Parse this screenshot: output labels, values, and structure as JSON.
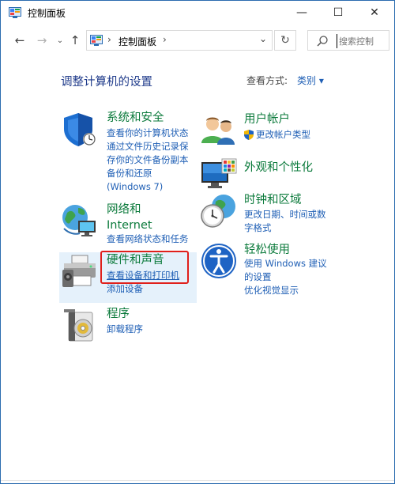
{
  "window": {
    "title": "控制面板",
    "controls": {
      "minimize": "—",
      "maximize": "☐",
      "close": "✕"
    }
  },
  "nav": {
    "back": "←",
    "forward": "→",
    "recent": "⌄",
    "up": "↑",
    "address_chevron_1": "›",
    "address_text": "控制面板",
    "address_chevron_2": "›",
    "address_dropdown": "⌄",
    "refresh": "↻",
    "search_placeholder": "搜索控制"
  },
  "main": {
    "heading": "调整计算机的设置",
    "view_by_label": "查看方式:",
    "view_by_value": "类别 ▾",
    "categories": [
      {
        "title": "系统和安全",
        "icon": "shield-icon",
        "links": [
          "查看你的计算机状态",
          "通过文件历史记录保",
          "存你的文件备份副本",
          "备份和还原",
          "(Windows 7)"
        ]
      },
      {
        "title_line1": "网络和",
        "title_line2": "Internet",
        "icon": "network-globe-icon",
        "links": [
          "查看网络状态和任务"
        ]
      },
      {
        "title": "硬件和声音",
        "icon": "printer-icon",
        "links": [
          "查看设备和打印机",
          "添加设备"
        ]
      },
      {
        "title": "程序",
        "icon": "programs-disc-icon",
        "links": [
          "卸载程序"
        ]
      },
      {
        "title": "用户帐户",
        "icon": "users-icon",
        "links": [
          "更改帐户类型"
        ]
      },
      {
        "title": "外观和个性化",
        "icon": "monitor-palette-icon",
        "links": []
      },
      {
        "title": "时钟和区域",
        "icon": "clock-globe-icon",
        "links": [
          "更改日期、时间或数",
          "字格式"
        ]
      },
      {
        "title": "轻松使用",
        "icon": "ease-of-access-icon",
        "links": [
          "使用 Windows 建议",
          "的设置",
          "优化视觉显示"
        ]
      }
    ]
  },
  "colors": {
    "heading": "#1e3a8a",
    "category_title": "#0b7a3b",
    "link": "#1f5fb5",
    "highlight_box": "#e0201b",
    "hover_bg": "#e5f1fb"
  }
}
